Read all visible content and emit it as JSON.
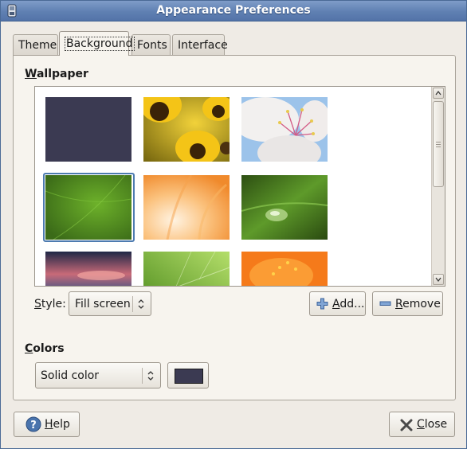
{
  "window": {
    "title": "Appearance Preferences"
  },
  "tabs": [
    {
      "label": "Theme"
    },
    {
      "label": "Background"
    },
    {
      "label": "Fonts"
    },
    {
      "label": "Interface"
    }
  ],
  "wallpaper": {
    "heading_mnemonic": "W",
    "heading_rest": "allpaper",
    "items": [
      {
        "name": "solid dark slate",
        "color": "#3b3a52"
      },
      {
        "name": "sunflowers",
        "color": "#d6a40d"
      },
      {
        "name": "white blossom",
        "color": "#dfe6ee"
      },
      {
        "name": "green leaf blur",
        "color": "#4f8d1e",
        "selected": true
      },
      {
        "name": "orange lily",
        "color": "#f6b56a"
      },
      {
        "name": "water drop",
        "color": "#3e6a1f"
      },
      {
        "name": "sunset clouds",
        "color": "#4a4f78"
      },
      {
        "name": "leaf veins",
        "color": "#8ec23d"
      },
      {
        "name": "orange flower",
        "color": "#f57a1a"
      }
    ]
  },
  "style": {
    "label_mnemonic": "S",
    "label_rest": "tyle:",
    "value": "Fill screen"
  },
  "buttons": {
    "add": {
      "mnemonic": "A",
      "rest": "dd..."
    },
    "remove": {
      "mnemonic": "R",
      "rest": "emove"
    },
    "help": {
      "mnemonic": "H",
      "rest": "elp"
    },
    "close": {
      "mnemonic": "C",
      "rest": "lose"
    }
  },
  "colors": {
    "heading_mnemonic": "C",
    "heading_rest": "olors",
    "mode_value": "Solid color",
    "swatch_color": "#3b3a52"
  }
}
